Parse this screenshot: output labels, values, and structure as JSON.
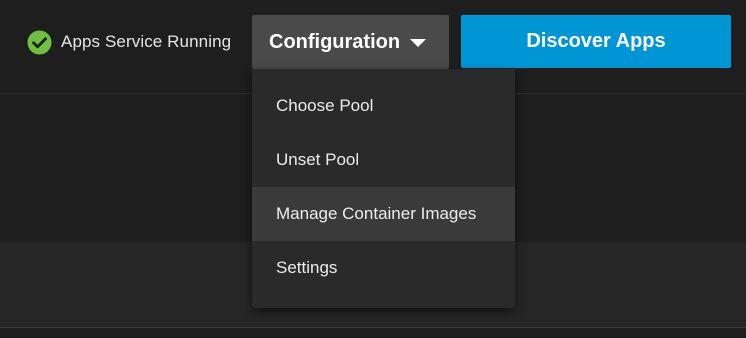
{
  "header": {
    "status": {
      "icon": "check-circle-icon",
      "label": "Apps Service Running",
      "color": "#6fbf40"
    },
    "configuration_button": {
      "label": "Configuration",
      "icon": "caret-down-icon"
    },
    "discover_button": {
      "label": "Discover Apps",
      "color": "#0095d5"
    }
  },
  "configuration_menu": {
    "items": [
      {
        "label": "Choose Pool"
      },
      {
        "label": "Unset Pool"
      },
      {
        "label": "Manage Container Images",
        "highlighted": true
      },
      {
        "label": "Settings"
      }
    ]
  }
}
